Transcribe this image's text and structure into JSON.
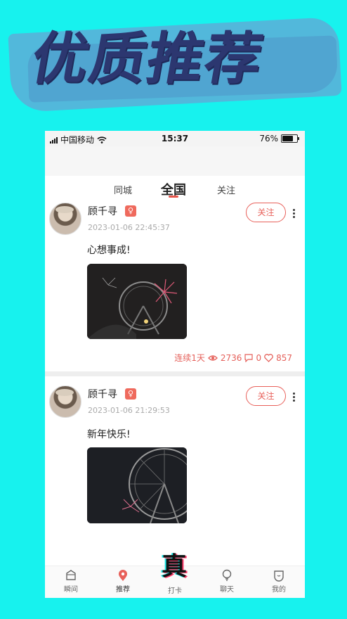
{
  "banner": {
    "title": "优质推荐"
  },
  "status_bar": {
    "carrier": "中国移动",
    "time": "15:37",
    "battery": "76%"
  },
  "tabs": [
    {
      "label": "同城",
      "active": false
    },
    {
      "label": "全国",
      "active": true
    },
    {
      "label": "关注",
      "active": false
    }
  ],
  "posts": [
    {
      "username": "顾千寻",
      "badge": "♀",
      "time": "2023-01-06 22:45:37",
      "follow_label": "关注",
      "text": "心想事成!",
      "streak": "连续1天",
      "views": "2736",
      "comments": "0",
      "likes": "857"
    },
    {
      "username": "顾千寻",
      "badge": "♀",
      "time": "2023-01-06 21:29:53",
      "follow_label": "关注",
      "text": "新年快乐!"
    }
  ],
  "bottom_nav": [
    {
      "label": "瞬间",
      "icon": "moments-icon"
    },
    {
      "label": "推荐",
      "icon": "location-pin-icon",
      "active": true
    },
    {
      "label": "打卡",
      "icon": "checkin-icon",
      "center_glyph": "真"
    },
    {
      "label": "聊天",
      "icon": "chat-bulb-icon"
    },
    {
      "label": "我的",
      "icon": "profile-icon"
    }
  ],
  "colors": {
    "background": "#17f2ee",
    "accent": "#e8605a",
    "banner_text": "#2c3770"
  }
}
